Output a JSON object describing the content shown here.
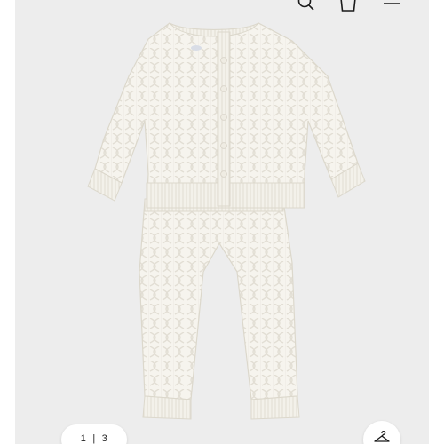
{
  "header": {
    "icons": [
      "search-icon",
      "shopping-bag-icon",
      "menu-icon"
    ]
  },
  "product_image": {
    "subject": "cable-knit-cardigan-and-pants-set",
    "color": "#f6f4ee"
  },
  "gallery": {
    "current_page": "1",
    "separator": "|",
    "total_pages": "3"
  },
  "actions": {
    "hanger_icon": "hanger-icon"
  },
  "colors": {
    "background": "#ededed",
    "garment": "#f6f4ee",
    "garment_shadow": "#e3e0d7",
    "icon": "#1a1a1a"
  }
}
